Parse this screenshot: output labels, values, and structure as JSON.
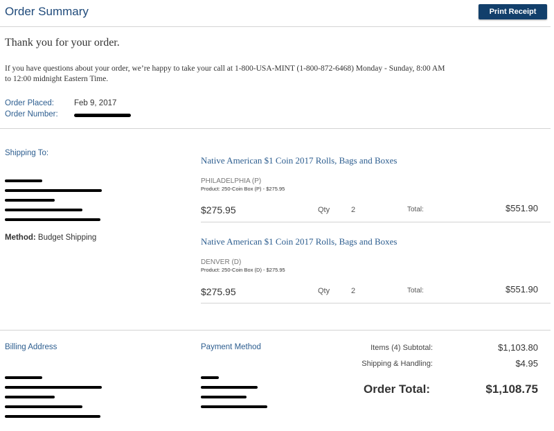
{
  "header": {
    "title": "Order Summary",
    "print_label": "Print Receipt"
  },
  "intro": {
    "thank_you": "Thank you for your order.",
    "info_line1": "If you have questions about your order, we’re happy to take your call at 1-800-USA-MINT (1-800-872-6468) Monday - Sunday, 8:00 AM",
    "info_line2": "to 12:00 midnight Eastern Time."
  },
  "order": {
    "placed_label": "Order Placed:",
    "placed_value": "Feb 9, 2017",
    "number_label": "Order Number:"
  },
  "shipping": {
    "heading": "Shipping To:",
    "method_label": "Method:",
    "method_value": "Budget Shipping"
  },
  "items": [
    {
      "title": "Native American $1 Coin 2017 Rolls, Bags and Boxes",
      "mint": "PHILADELPHIA (P)",
      "product_line": "Product: 250-Coin Box (P) - $275.95",
      "price": "$275.95",
      "qty_label": "Qty",
      "qty": "2",
      "total_label": "Total:",
      "total": "$551.90"
    },
    {
      "title": "Native American $1 Coin 2017 Rolls, Bags and Boxes",
      "mint": "DENVER (D)",
      "product_line": "Product: 250-Coin Box (D) - $275.95",
      "price": "$275.95",
      "qty_label": "Qty",
      "qty": "2",
      "total_label": "Total:",
      "total": "$551.90"
    }
  ],
  "billing": {
    "heading": "Billing Address"
  },
  "payment": {
    "heading": "Payment Method"
  },
  "summary": {
    "subtotal_label": "Items (4) Subtotal:",
    "subtotal_value": "$1,103.80",
    "shipping_label": "Shipping & Handling:",
    "shipping_value": "$4.95",
    "grand_label": "Order Total:",
    "grand_value": "$1,108.75"
  }
}
